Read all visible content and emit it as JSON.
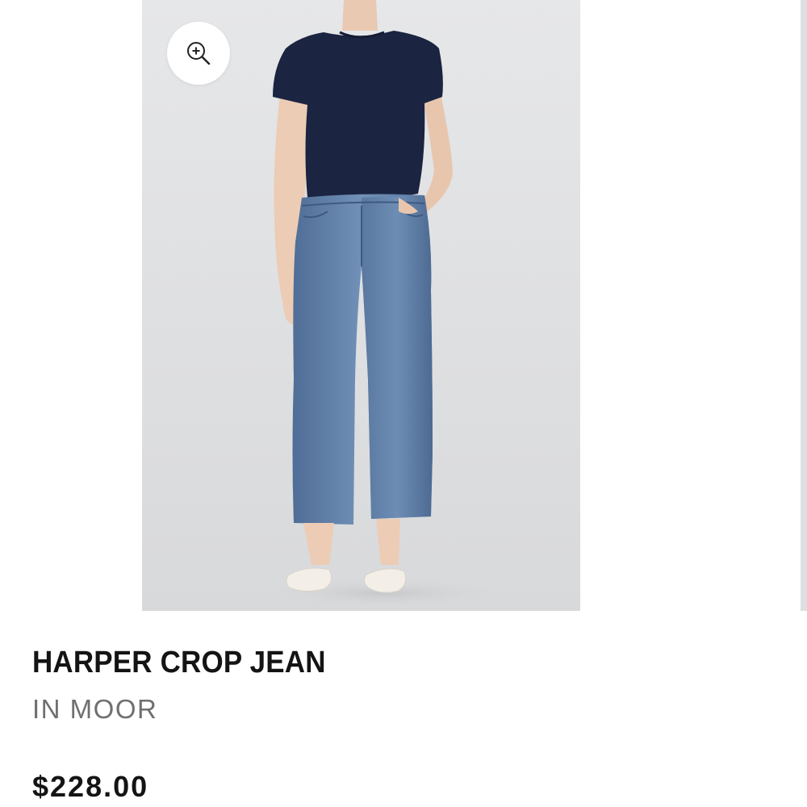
{
  "gallery": {
    "image_alt": "Model wearing navy t-shirt and cropped medium-wash jeans with white sandals",
    "zoom_icon": "zoom-in-icon"
  },
  "product": {
    "title": "HARPER CROP JEAN",
    "color": "IN MOOR",
    "price": "$228.00"
  },
  "colors": {
    "background": "#ffffff",
    "image_background": "#e2e3e5",
    "tee": "#1b2440",
    "denim": "#5f7fa8",
    "title_text": "#141414",
    "subtitle_text": "#6f6f6f"
  }
}
